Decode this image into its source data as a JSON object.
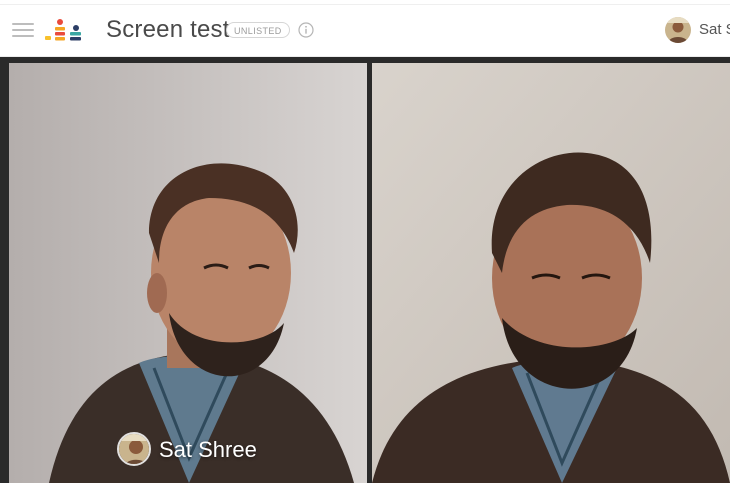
{
  "header": {
    "title": "Screen test",
    "badge": "UNLISTED",
    "user_name": "Sat S"
  },
  "icons": {
    "menu": "hamburger-menu-icon",
    "logo": "app-logo-icon",
    "info": "info-circle-icon",
    "avatar": "user-avatar"
  },
  "video_tiles": [
    {
      "participant_name": "Sat Shree"
    },
    {
      "participant_name": ""
    }
  ],
  "colors": {
    "logo_orange": "#f5a623",
    "logo_red": "#e94b3c",
    "logo_yellow": "#f8c12c",
    "logo_navy": "#2c3e66",
    "logo_teal": "#3aa7a3"
  }
}
